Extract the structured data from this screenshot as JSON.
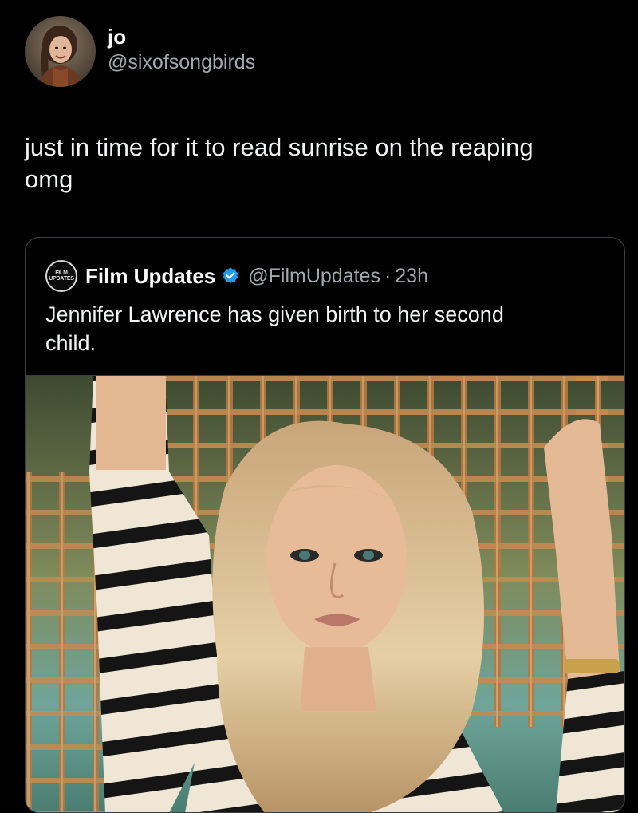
{
  "tweet": {
    "author": {
      "display_name": "jo",
      "handle": "@sixofsongbirds",
      "avatar_icon": "user-avatar"
    },
    "text_line1": "just in time for it to read sunrise on the reaping",
    "text_line2": "omg"
  },
  "quoted_tweet": {
    "avatar_line1": "FILM",
    "avatar_line2": "UPDATES",
    "display_name": "Film Updates",
    "verified_icon": "verified-badge-icon",
    "handle": "@FilmUpdates",
    "separator": "·",
    "time": "23h",
    "text_line1": "Jennifer Lawrence has given birth to her second",
    "text_line2": "child.",
    "media_icon": "photo",
    "colors": {
      "verified": "#1d9bf0",
      "border": "#3a3f44",
      "secondary_text": "#a3a8ad"
    }
  }
}
